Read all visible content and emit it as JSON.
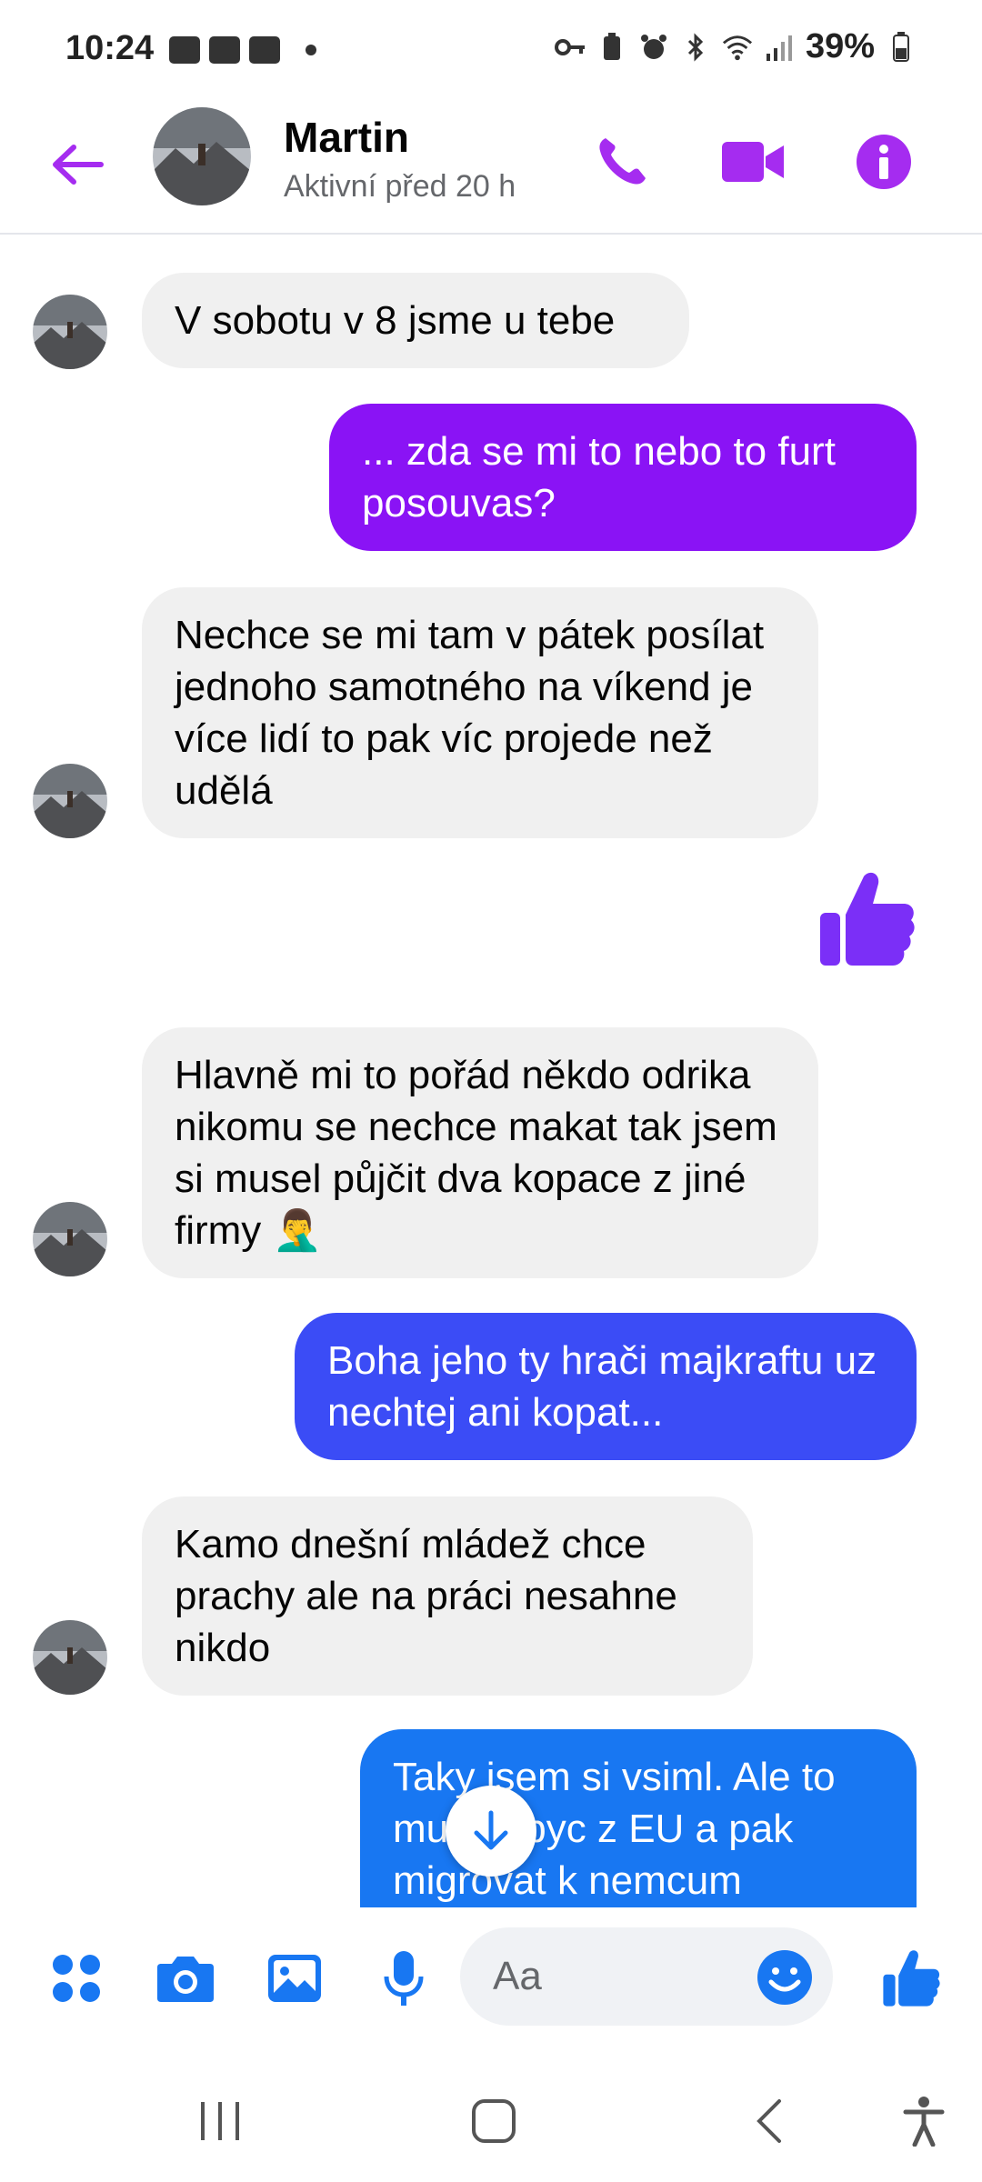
{
  "status_bar": {
    "time": "10:24",
    "battery": "39%",
    "left_icons": [
      "image-icon",
      "sim-icon",
      "youtube-icon",
      "dot-icon"
    ],
    "right_icons": [
      "key-icon",
      "battery-saver-icon",
      "alarm-icon",
      "bluetooth-icon",
      "wifi-icon",
      "signal-icon"
    ]
  },
  "header": {
    "name": "Martin",
    "status": "Aktivní před 20 h"
  },
  "messages": [
    {
      "dir": "in",
      "text": "V sobotu v 8 jsme u tebe"
    },
    {
      "dir": "out",
      "text": "... zda se mi to nebo to furt posouvas?",
      "color": "#8a13f5"
    },
    {
      "dir": "in",
      "text": "Nechce se mi tam v pátek posílat jednoho samotného na víkend je více lidí to pak víc projede než udělá"
    },
    {
      "dir": "like",
      "color": "#7b2ff7"
    },
    {
      "dir": "in",
      "text": "Hlavně mi to pořád někdo odrika nikomu se nechce makat tak jsem si musel půjčit dva kopace z jiné firmy 🤦‍♂️"
    },
    {
      "dir": "out",
      "text": "Boha jeho ty hrači majkraftu uz nechtej ani kopat...",
      "color": "#3b4cf6"
    },
    {
      "dir": "in",
      "text": "Kamo dnešní mládež chce prachy ale na práci nesahne nikdo"
    },
    {
      "dir": "out",
      "text": "Taky jsem si vsiml. Ale to muzou byc z EU a pak migrovat k nemcum",
      "color": "#1877f2"
    }
  ],
  "composer": {
    "placeholder": "Aa"
  },
  "colors": {
    "accent_purple": "#a52cf0",
    "accent_blue": "#1877f2"
  }
}
